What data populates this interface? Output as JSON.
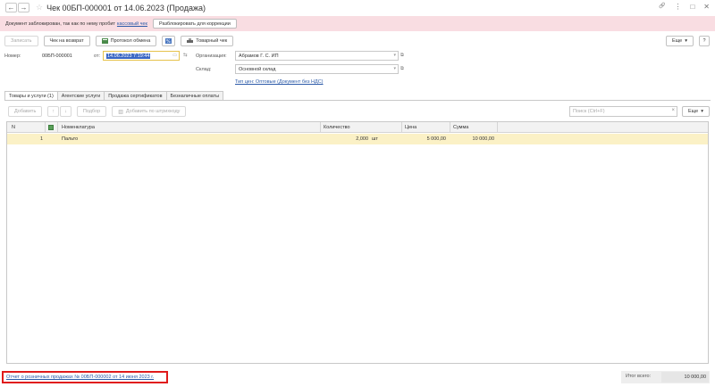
{
  "window": {
    "title": "Чек 00БП-000001 от 14.06.2023 (Продажа)",
    "back_icon": "←",
    "forward_icon": "→",
    "star_icon": "☆",
    "link_icon": "🔗",
    "menu_icon": "⋮",
    "max_icon": "□",
    "close_icon": "✕"
  },
  "alert": {
    "message": "Документ заблокирован, так как по нему пробит",
    "link": "кассовый чек",
    "unlock_button": "Разблокировать для коррекции"
  },
  "toolbar": {
    "post": "Записать",
    "return_check": "Чек на возврат",
    "exchange_log": "Протокол обмена",
    "goods_check": "Товарный чек",
    "more": "Еще",
    "help": "?"
  },
  "header": {
    "number_label": "Номер:",
    "number_value": "00БП-000001",
    "date_label": "от:",
    "date_value": "14.06.2023  7:19:44",
    "org_label": "Организация:",
    "org_value": "Абрамов Г. С. ИП",
    "warehouse_label": "Склад:",
    "warehouse_value": "Основной склад",
    "price_link": "Тип цен: Оптовые (Документ без НДС)"
  },
  "tabs": [
    {
      "label": "Товары и услуги (1)"
    },
    {
      "label": "Агентские услуги"
    },
    {
      "label": "Продажа сертификатов"
    },
    {
      "label": "Безналичные оплаты"
    }
  ],
  "table_toolbar": {
    "add": "Добавить",
    "up": "↑",
    "down": "↓",
    "select": "Подбор",
    "add_barcode": "Добавить по штрихкоду",
    "search_placeholder": "Поиск (Ctrl+F)",
    "clear": "×",
    "more": "Еще"
  },
  "table": {
    "columns": [
      "N",
      "Номенклатура",
      "Количество",
      "Цена",
      "Сумма"
    ],
    "rows": [
      {
        "n": "1",
        "item": "Пальто",
        "qty": "2,000",
        "unit": "шт",
        "price": "5 000,00",
        "sum": "10 000,00"
      }
    ]
  },
  "footer": {
    "report_link": "Отчет о розничных продажах № 00БП-000002 от 14 июня 2023 г.",
    "total_label": "Итог всего:",
    "total_value": "10 000,00"
  },
  "colors": {
    "alert_bg": "#f9dde2",
    "selected_row": "#fbf1c6",
    "link": "#2b5aa8",
    "highlight_border": "#e01b1b"
  }
}
